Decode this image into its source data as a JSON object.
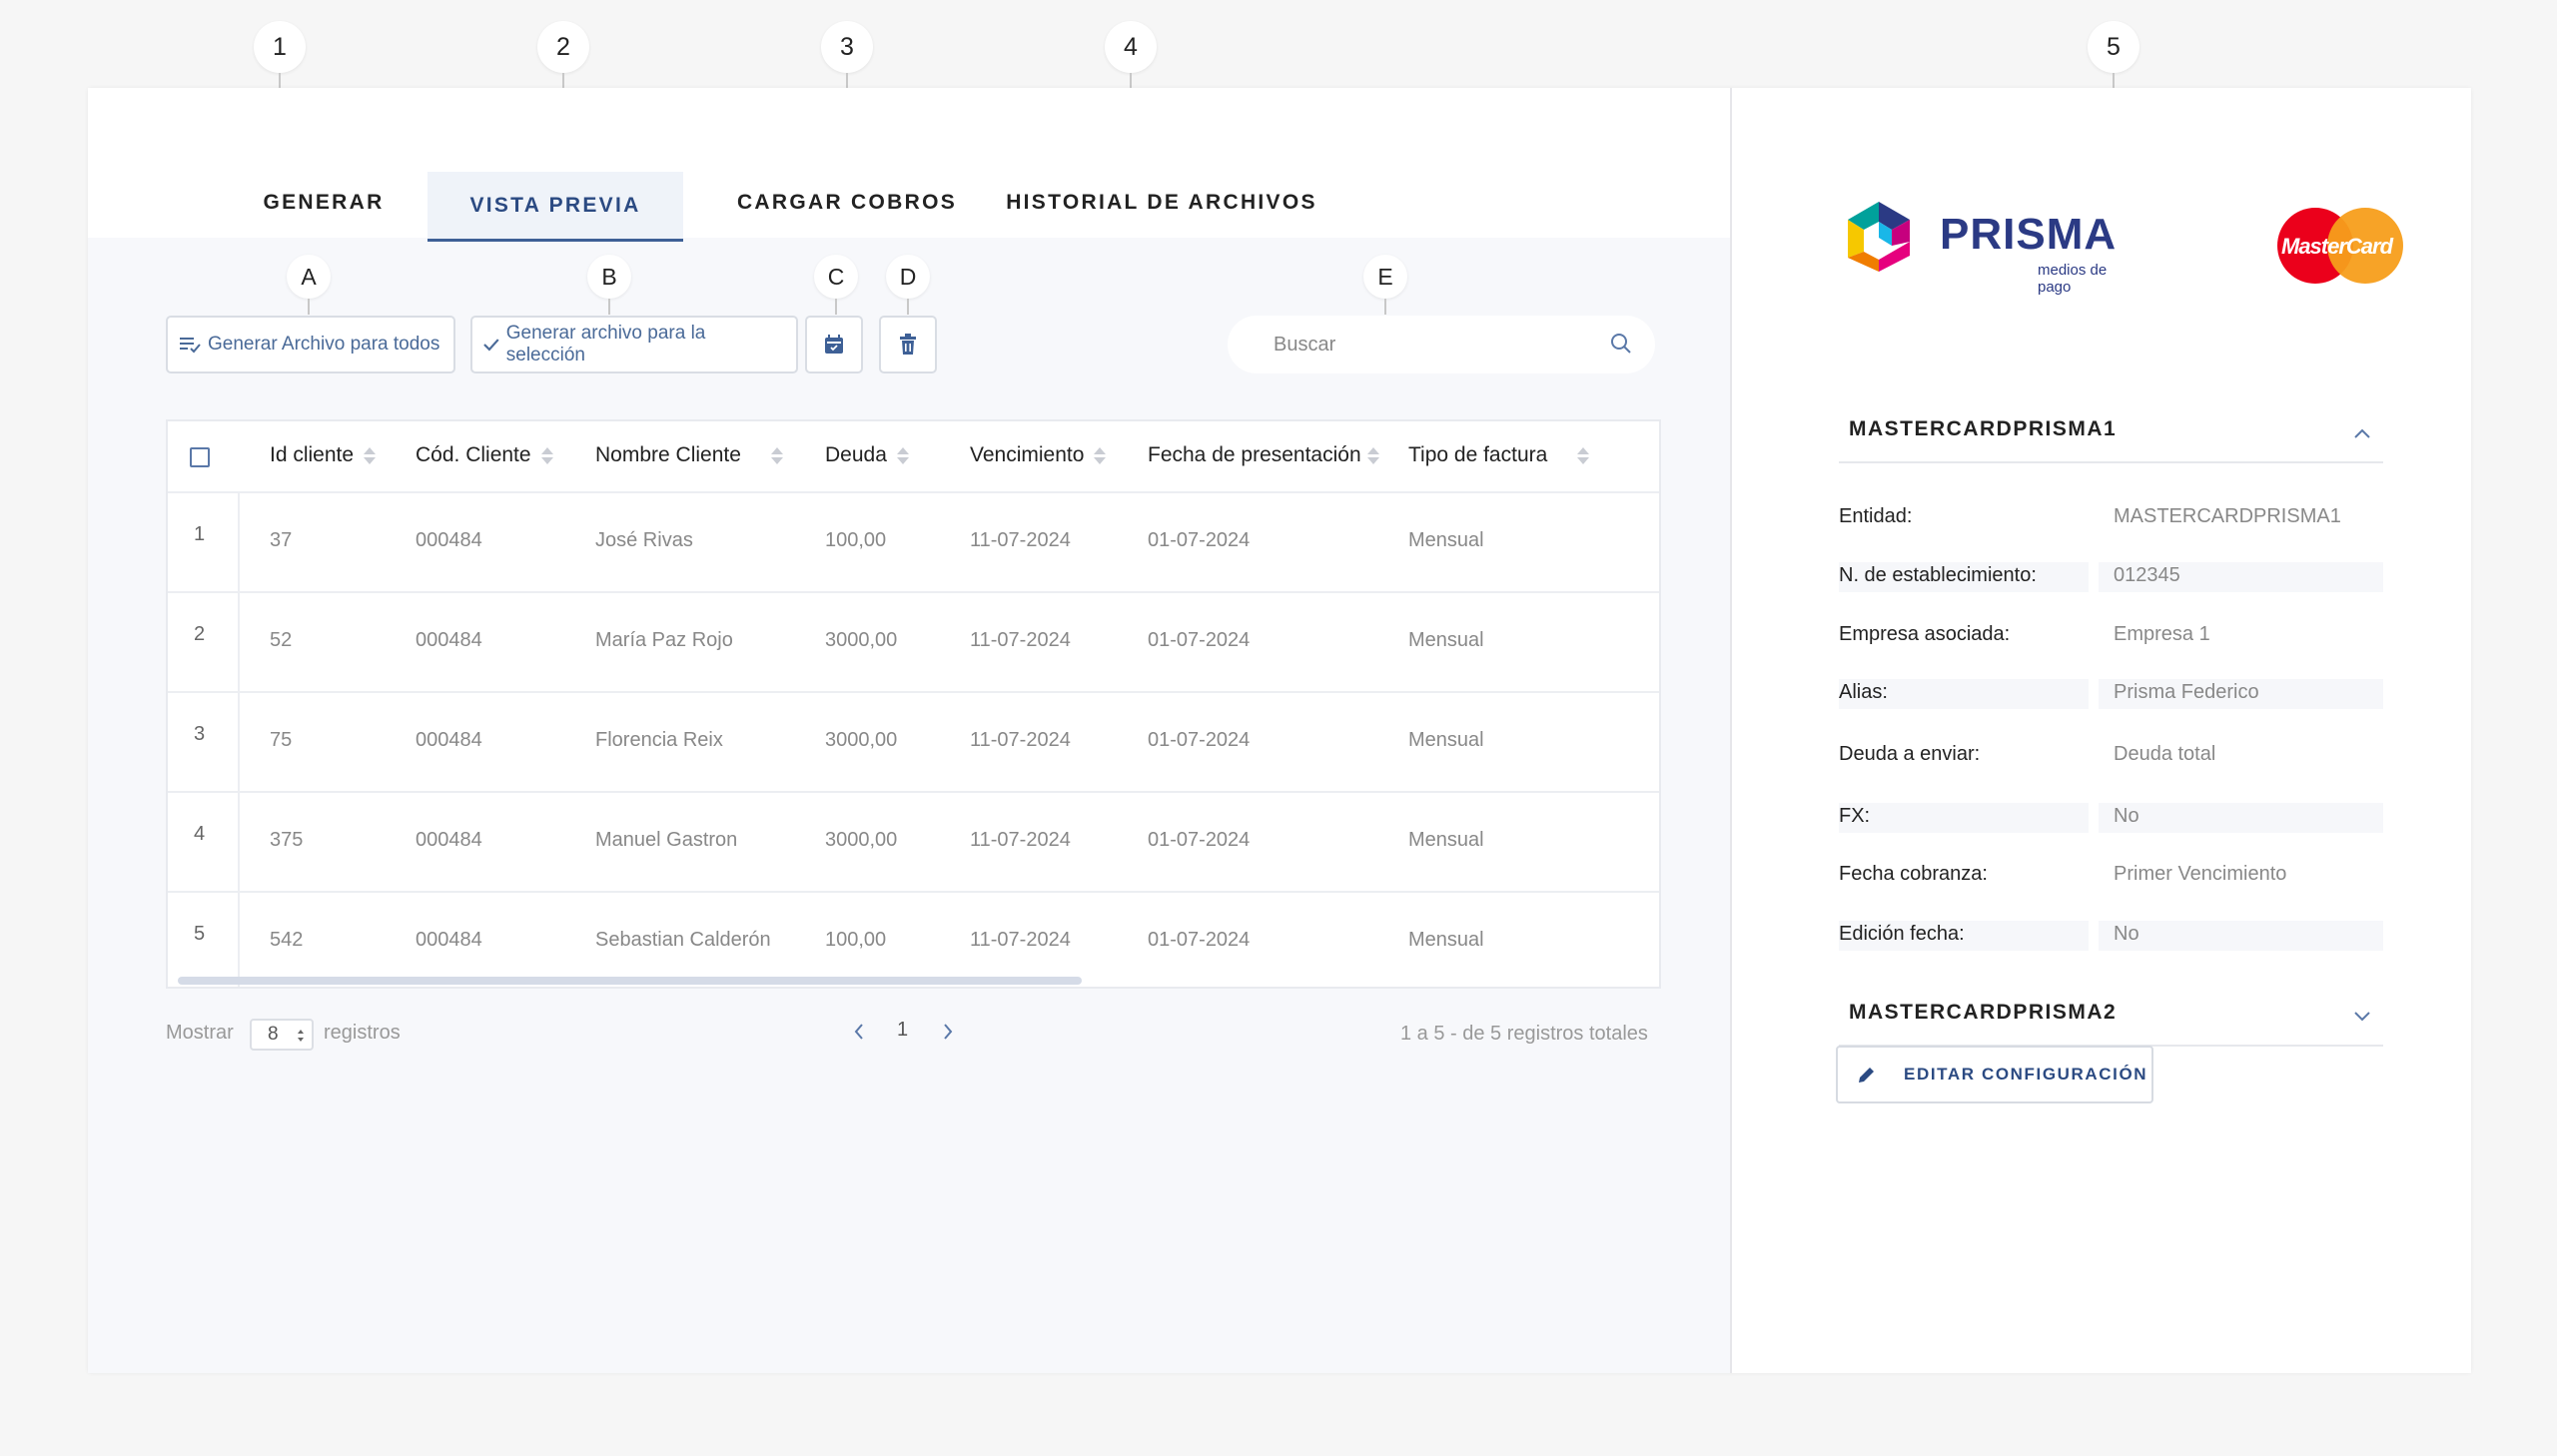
{
  "markers": [
    "1",
    "2",
    "3",
    "4",
    "5",
    "A",
    "B",
    "C",
    "D",
    "E"
  ],
  "tabs": [
    {
      "label": "GENERAR"
    },
    {
      "label": "VISTA PREVIA"
    },
    {
      "label": "CARGAR COBROS"
    },
    {
      "label": "HISTORIAL DE ARCHIVOS"
    }
  ],
  "active_tab": "VISTA PREVIA",
  "toolbar": {
    "generate_all_label": "Generar Archivo para todos",
    "generate_selection_label": "Generar archivo para la selección"
  },
  "search": {
    "placeholder": "Buscar"
  },
  "table": {
    "columns": [
      "Id cliente",
      "Cód. Cliente",
      "Nombre Cliente",
      "Deuda",
      "Vencimiento",
      "Fecha de presentación",
      "Tipo de factura"
    ],
    "rows": [
      {
        "index": "1",
        "id": "37",
        "code": "000484",
        "name": "José Rivas",
        "debt": "100,00",
        "due": "11-07-2024",
        "presented": "01-07-2024",
        "type": "Mensual"
      },
      {
        "index": "2",
        "id": "52",
        "code": "000484",
        "name": "María Paz Rojo",
        "debt": "3000,00",
        "due": "11-07-2024",
        "presented": "01-07-2024",
        "type": "Mensual"
      },
      {
        "index": "3",
        "id": "75",
        "code": "000484",
        "name": "Florencia Reix",
        "debt": "3000,00",
        "due": "11-07-2024",
        "presented": "01-07-2024",
        "type": "Mensual"
      },
      {
        "index": "4",
        "id": "375",
        "code": "000484",
        "name": "Manuel Gastron",
        "debt": "3000,00",
        "due": "11-07-2024",
        "presented": "01-07-2024",
        "type": "Mensual"
      },
      {
        "index": "5",
        "id": "542",
        "code": "000484",
        "name": "Sebastian Calderón",
        "debt": "100,00",
        "due": "11-07-2024",
        "presented": "01-07-2024",
        "type": "Mensual"
      }
    ]
  },
  "pagination": {
    "show_label": "Mostrar",
    "page_size": "8",
    "records_label": "registros",
    "current_page": "1",
    "summary": "1 a 5 - de 5 registros totales"
  },
  "brand": {
    "prisma_name": "PRISMA",
    "prisma_tagline": "medios de pago",
    "mastercard_name": "MasterCard",
    "colors": {
      "prisma_blue": "#2b3a84",
      "mc_red": "#eb001b",
      "mc_orange": "#f79e1b"
    }
  },
  "config": {
    "accordion_1_title": "MASTERCARDPRISMA1",
    "accordion_2_title": "MASTERCARDPRISMA2",
    "fields": [
      {
        "label": "Entidad:",
        "value": "MASTERCARDPRISMA1"
      },
      {
        "label": "N. de establecimiento:",
        "value": "012345"
      },
      {
        "label": "Empresa asociada:",
        "value": "Empresa 1"
      },
      {
        "label": "Alias:",
        "value": "Prisma Federico"
      },
      {
        "label": "Deuda a enviar:",
        "value": "Deuda total"
      },
      {
        "label": "FX:",
        "value": "No"
      },
      {
        "label": "Fecha cobranza:",
        "value": "Primer Vencimiento"
      },
      {
        "label": "Edición fecha:",
        "value": "No"
      }
    ],
    "edit_button_label": "EDITAR CONFIGURACIÓN"
  }
}
